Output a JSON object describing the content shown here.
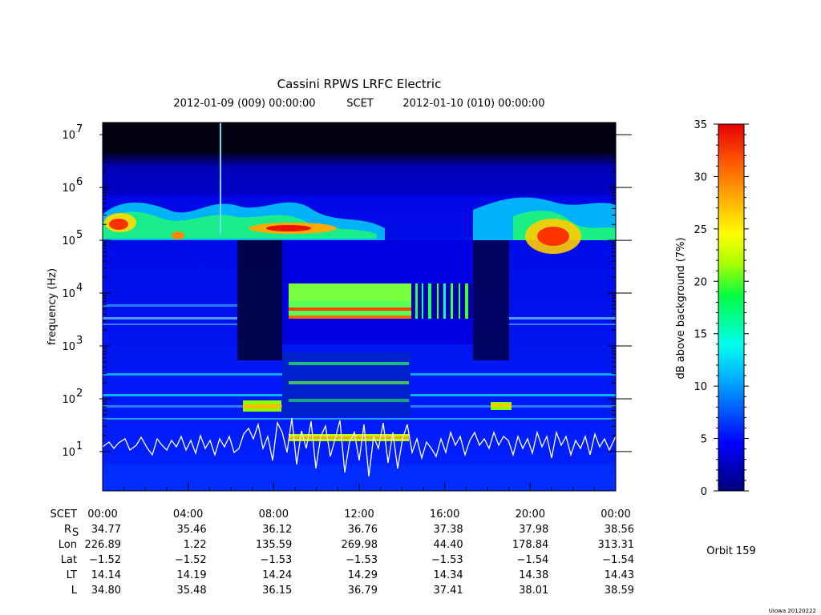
{
  "chart_data": {
    "type": "heatmap",
    "title": "Cassini RPWS LRFC Electric",
    "subtitle": {
      "start": "2012-01-09 (009) 00:00:00",
      "frame": "SCET",
      "end": "2012-01-10 (010) 00:00:00"
    },
    "ylabel": "frequency (Hz)",
    "y_scale": "log",
    "ylim": [
      1.8,
      17000000
    ],
    "y_ticks": [
      {
        "base": "10",
        "exp": "7",
        "value": 10000000
      },
      {
        "base": "10",
        "exp": "6",
        "value": 1000000
      },
      {
        "base": "10",
        "exp": "5",
        "value": 100000
      },
      {
        "base": "10",
        "exp": "4",
        "value": 10000
      },
      {
        "base": "10",
        "exp": "3",
        "value": 1000
      },
      {
        "base": "10",
        "exp": "2",
        "value": 100
      },
      {
        "base": "10",
        "exp": "1",
        "value": 10
      }
    ],
    "xlim_hours": [
      0,
      24
    ],
    "colorbar": {
      "label": "dB above background (7%)",
      "range": [
        0,
        35
      ],
      "ticks": [
        "0",
        "5",
        "10",
        "15",
        "20",
        "25",
        "30",
        "35"
      ],
      "colors": [
        "#00007a",
        "#0000ff",
        "#00aaff",
        "#00ffee",
        "#00ff44",
        "#aaff00",
        "#ffff00",
        "#ffaa00",
        "#ff5500",
        "#e60000"
      ]
    },
    "overlay_line": {
      "color": "#ffffff",
      "description_visible": false
    },
    "ephemeris": {
      "columns": [
        "00:00",
        "04:00",
        "08:00",
        "12:00",
        "16:00",
        "20:00",
        "00:00"
      ],
      "rows": [
        {
          "label": "SCET",
          "values": [
            "00:00",
            "04:00",
            "08:00",
            "12:00",
            "16:00",
            "20:00",
            "00:00"
          ]
        },
        {
          "label": "R",
          "sub": "S",
          "values": [
            "34.77",
            "35.46",
            "36.12",
            "36.76",
            "37.38",
            "37.98",
            "38.56"
          ]
        },
        {
          "label": "Lon",
          "values": [
            "226.89",
            "1.22",
            "135.59",
            "269.98",
            "44.40",
            "178.84",
            "313.31"
          ]
        },
        {
          "label": "Lat",
          "values": [
            "−1.52",
            "−1.52",
            "−1.53",
            "−1.53",
            "−1.53",
            "−1.54",
            "−1.54"
          ]
        },
        {
          "label": "LT",
          "values": [
            "14.14",
            "14.19",
            "14.24",
            "14.29",
            "14.34",
            "14.38",
            "14.43"
          ]
        },
        {
          "label": "L",
          "values": [
            "34.80",
            "35.48",
            "36.15",
            "36.79",
            "37.41",
            "38.01",
            "38.59"
          ]
        }
      ]
    }
  },
  "orbit": "Orbit 159",
  "footer": "Uiowa 20120222"
}
